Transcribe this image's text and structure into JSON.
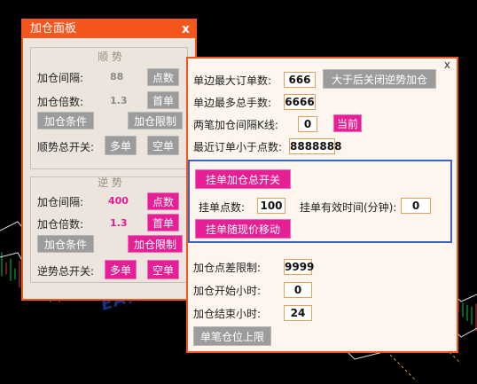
{
  "panel1": {
    "title": "加仓面板",
    "close": "x",
    "trend": {
      "title": "顺 势",
      "interval_label": "加仓间隔:",
      "interval_value": "88",
      "points_btn": "点数",
      "multiplier_label": "加仓倍数:",
      "multiplier_value": "1.3",
      "first_btn": "首单",
      "condition_btn": "加仓条件",
      "limit_btn": "加仓限制",
      "switch_label": "顺势总开关:",
      "buy_btn": "多单",
      "sell_btn": "空单"
    },
    "counter": {
      "title": "逆 势",
      "interval_label": "加仓间隔:",
      "interval_value": "400",
      "points_btn": "点数",
      "multiplier_label": "加仓倍数:",
      "multiplier_value": "1.3",
      "first_btn": "首单",
      "condition_btn": "加仓条件",
      "limit_btn": "加仓限制",
      "switch_label": "逆势总开关:",
      "buy_btn": "多单",
      "sell_btn": "空单"
    }
  },
  "panel2": {
    "close": "x",
    "max_orders_label": "单边最大订单数:",
    "max_orders_value": "666",
    "close_counter_btn": "大于后关闭逆势加仓",
    "max_lots_label": "单边最多总手数:",
    "max_lots_value": "6666",
    "kline_gap_label": "两笔加仓间隔K线:",
    "kline_gap_value": "0",
    "current_btn": "当前",
    "recent_order_label": "最近订单小于点数:",
    "recent_order_value": "8888888",
    "pending_switch_btn": "挂单加仓总开关",
    "pending_points_label": "挂单点数:",
    "pending_points_value": "100",
    "pending_valid_label": "挂单有效时间(分钟):",
    "pending_valid_value": "0",
    "pending_follow_btn": "挂单随现价移动",
    "spread_limit_label": "加仓点差限制:",
    "spread_limit_value": "9999",
    "start_hour_label": "加仓开始小时:",
    "start_hour_value": "0",
    "end_hour_label": "加仓结束小时:",
    "end_hour_value": "24",
    "single_limit_btn": "单笔仓位上限"
  },
  "watermark": "EA邦www.eabang.com",
  "colors": {
    "panel_border": "#f4561e",
    "pink": "#e61f94",
    "gray_button": "#9c9c9c",
    "highlight_box": "#3b63c7"
  }
}
